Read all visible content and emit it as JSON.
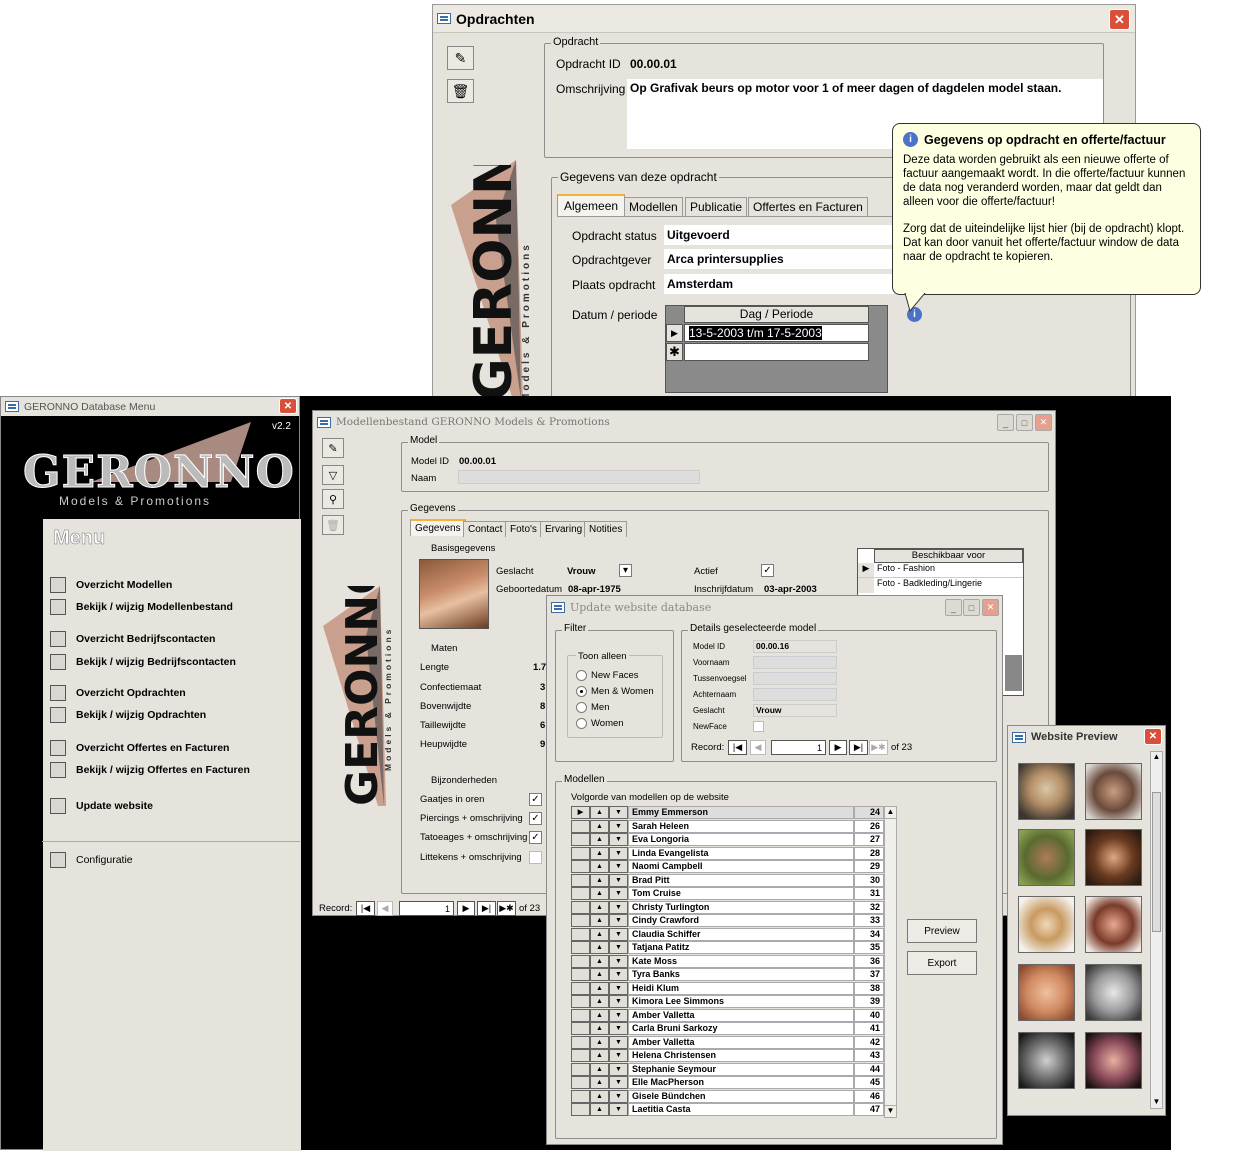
{
  "opdrachten": {
    "title": "Opdrachten",
    "opdracht_legend": "Opdracht",
    "opdracht_id_label": "Opdracht ID",
    "opdracht_id": "00.00.01",
    "omschrijving_label": "Omschrijving",
    "omschrijving": "Op Grafivak beurs op motor voor 1 of meer dagen of dagdelen model staan.",
    "gegevens_legend": "Gegevens van deze opdracht",
    "tabs": [
      "Algemeen",
      "Modellen",
      "Publicatie",
      "Offertes en Facturen"
    ],
    "status_label": "Opdracht status",
    "status": "Uitgevoerd",
    "gever_label": "Opdrachtgever",
    "gever": "Arca printersupplies",
    "plaats_label": "Plaats opdracht",
    "plaats": "Amsterdam",
    "datum_label": "Datum / periode",
    "datum_header": "Dag / Periode",
    "datum_value": "13-5-2003 t/m 17-5-2003",
    "tooltip_title": "Gegevens op opdracht en offerte/factuur",
    "tooltip_p1": "Deze data worden gebruikt als een nieuwe offerte of factuur aangemaakt wordt. In die offerte/factuur kunnen de data nog veranderd worden, maar dat geldt dan alleen voor die offerte/factuur!",
    "tooltip_p2": "Zorg dat de uiteindelijke lijst hier (bij de opdracht) klopt. Dat kan door vanuit het offerte/factuur window de data naar de opdracht te kopieren.",
    "logo": "GERONNO",
    "logo_sub": "Models & Promotions"
  },
  "menu": {
    "title": "GERONNO Database Menu",
    "version": "v2.2",
    "logo": "GERONNO",
    "logo_sub": "Models & Promotions",
    "heading": "Menu",
    "items": [
      "Overzicht Modellen",
      "Bekijk / wijzig Modellenbestand",
      "Overzicht Bedrijfscontacten",
      "Bekijk / wijzig Bedrijfscontacten",
      "Overzicht Opdrachten",
      "Bekijk / wijzig Opdrachten",
      "Overzicht Offertes en Facturen",
      "Bekijk / wijzig Offertes en Facturen",
      "Update website",
      "Configuratie"
    ]
  },
  "modellen": {
    "title": "Modellenbestand GERONNO Models & Promotions",
    "model_legend": "Model",
    "model_id_label": "Model ID",
    "model_id": "00.00.01",
    "naam_label": "Naam",
    "gegevens_legend": "Gegevens",
    "tabs": [
      "Gegevens",
      "Contact",
      "Foto's",
      "Ervaring",
      "Notities"
    ],
    "basis_legend": "Basisgegevens",
    "geslacht_label": "Geslacht",
    "geslacht": "Vrouw",
    "geboorte_label": "Geboortedatum",
    "geboorte": "08-apr-1975",
    "actief_label": "Actief",
    "inschrijf_label": "Inschrijfdatum",
    "inschrijf": "03-apr-2003",
    "maten_legend": "Maten",
    "maten": [
      {
        "label": "Lengte",
        "value": "1.7"
      },
      {
        "label": "Confectiemaat",
        "value": "3"
      },
      {
        "label": "Bovenwijdte",
        "value": "8"
      },
      {
        "label": "Taillewijdte",
        "value": "6"
      },
      {
        "label": "Heupwijdte",
        "value": "9"
      }
    ],
    "bijz_legend": "Bijzonderheden",
    "bijz": [
      "Gaatjes in oren",
      "Piercings + omschrijving",
      "Tatoeages + omschrijving",
      "Littekens + omschrijving"
    ],
    "beschikbaar_header": "Beschikbaar voor",
    "beschikbaar": [
      "Foto - Fashion",
      "Foto - Badkleding/Lingerie"
    ],
    "record_label": "Record:",
    "record_num": "1",
    "record_of": "of  23",
    "logo": "GERONNO",
    "logo_sub": "Models & Promotions"
  },
  "update": {
    "title": "Update website database",
    "filter_legend": "Filter",
    "toon_legend": "Toon alleen",
    "radios": [
      "New Faces",
      "Men & Women",
      "Men",
      "Women"
    ],
    "details_legend": "Details geselecteerde model",
    "fields": [
      "Model ID",
      "Voornaam",
      "Tussenvoegsel",
      "Achternaam",
      "Geslacht",
      "NewFace"
    ],
    "model_id": "00.00.16",
    "geslacht": "Vrouw",
    "record_label": "Record:",
    "record_num": "1",
    "record_of": "of  23",
    "modellen_legend": "Modellen",
    "volgorde_label": "Volgorde van modellen op de website",
    "list": [
      [
        "Emmy Emmerson",
        "24"
      ],
      [
        "Sarah Heleen",
        "26"
      ],
      [
        "Eva Longoria",
        "27"
      ],
      [
        "Linda Evangelista",
        "28"
      ],
      [
        "Naomi Campbell",
        "29"
      ],
      [
        "Brad Pitt",
        "30"
      ],
      [
        "Tom Cruise",
        "31"
      ],
      [
        "Christy Turlington",
        "32"
      ],
      [
        "Cindy Crawford",
        "33"
      ],
      [
        "Claudia Schiffer",
        "34"
      ],
      [
        "Tatjana Patitz",
        "35"
      ],
      [
        "Kate Moss",
        "36"
      ],
      [
        "Tyra Banks",
        "37"
      ],
      [
        "Heidi Klum",
        "38"
      ],
      [
        "Kimora Lee Simmons",
        "39"
      ],
      [
        "Amber Valletta",
        "40"
      ],
      [
        "Carla Bruni Sarkozy",
        "41"
      ],
      [
        "Amber Valletta",
        "42"
      ],
      [
        "Helena Christensen",
        "43"
      ],
      [
        "Stephanie Seymour",
        "44"
      ],
      [
        "Elle MacPherson",
        "45"
      ],
      [
        "Gisele Bündchen",
        "46"
      ],
      [
        "Laetitia Casta",
        "47"
      ]
    ],
    "preview_btn": "Preview",
    "export_btn": "Export"
  },
  "preview": {
    "title": "Website Preview"
  },
  "colors": {
    "win_bg": "#e6e3dc",
    "title_active": "#e6e3dc",
    "close_red": "#d9503a",
    "menu_dark": "#000000",
    "tooltip_bg": "#ffffe1"
  }
}
